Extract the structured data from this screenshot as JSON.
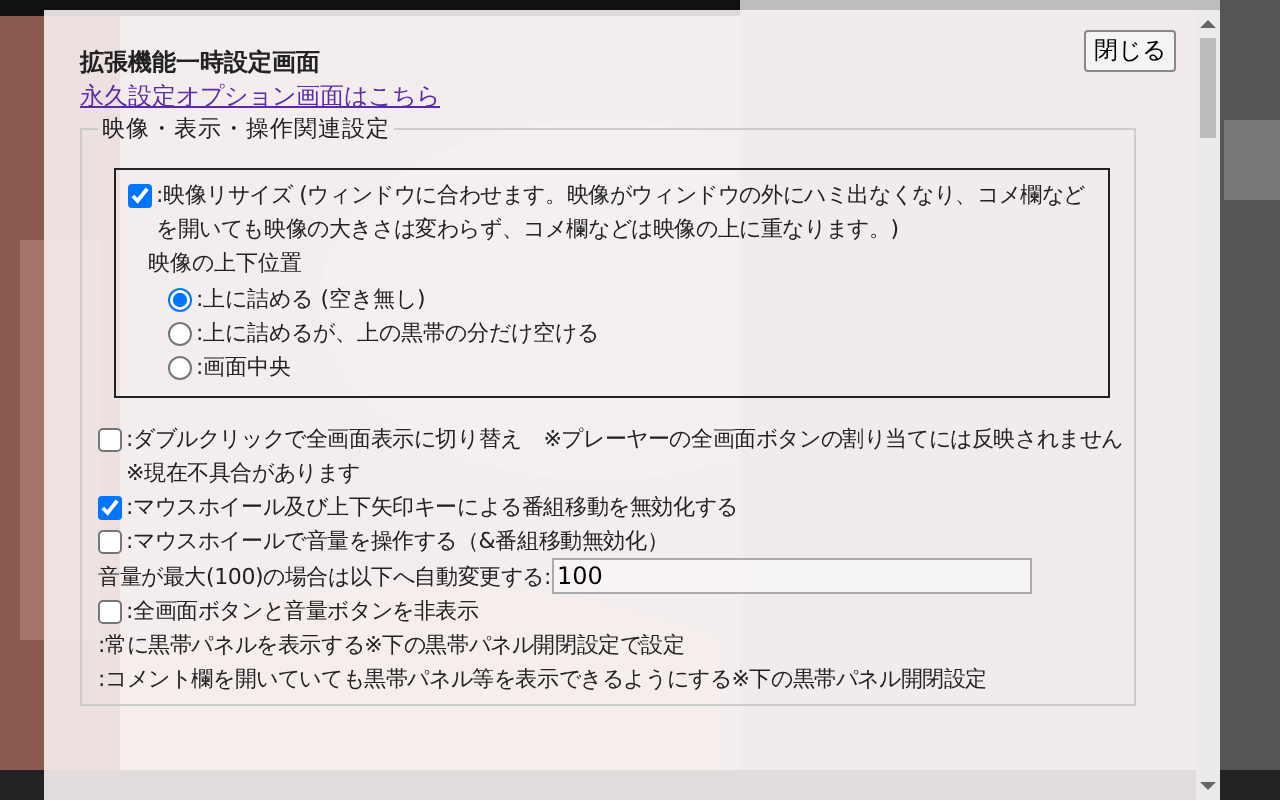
{
  "title": "拡張機能一時設定画面",
  "close_button": "閉じる",
  "link": "永久設定オプション画面はこちら",
  "section": {
    "legend": "映像・表示・操作関連設定",
    "resize": {
      "label": ":映像リサイズ (ウィンドウに合わせます。映像がウィンドウの外にハミ出なくなり、コメ欄などを開いても映像の大きさは変わらず、コメ欄などは映像の上に重なります。)",
      "checked": true,
      "position_heading": "映像の上下位置",
      "options": [
        {
          "label": ":上に詰める (空き無し)",
          "selected": true
        },
        {
          "label": ":上に詰めるが、上の黒帯の分だけ空ける",
          "selected": false
        },
        {
          "label": ":画面中央",
          "selected": false
        }
      ]
    },
    "settings": [
      {
        "kind": "checkbox",
        "label": ":ダブルクリックで全画面表示に切り替え　※プレーヤーの全画面ボタンの割り当てには反映されません※現在不具合があります",
        "checked": false
      },
      {
        "kind": "checkbox",
        "label": ":マウスホイール及び上下矢印キーによる番組移動を無効化する",
        "checked": true
      },
      {
        "kind": "checkbox",
        "label": ":マウスホイールで音量を操作する（&番組移動無効化）",
        "checked": false
      },
      {
        "kind": "input",
        "label": "音量が最大(100)の場合は以下へ自動変更する:",
        "value": "100"
      },
      {
        "kind": "checkbox",
        "label": ":全画面ボタンと音量ボタンを非表示",
        "checked": false
      },
      {
        "kind": "text",
        "label": ":常に黒帯パネルを表示する※下の黒帯パネル開閉設定で設定"
      },
      {
        "kind": "text",
        "label": ":コメント欄を開いていても黒帯パネル等を表示できるようにする※下の黒帯パネル開閉設定"
      }
    ]
  }
}
